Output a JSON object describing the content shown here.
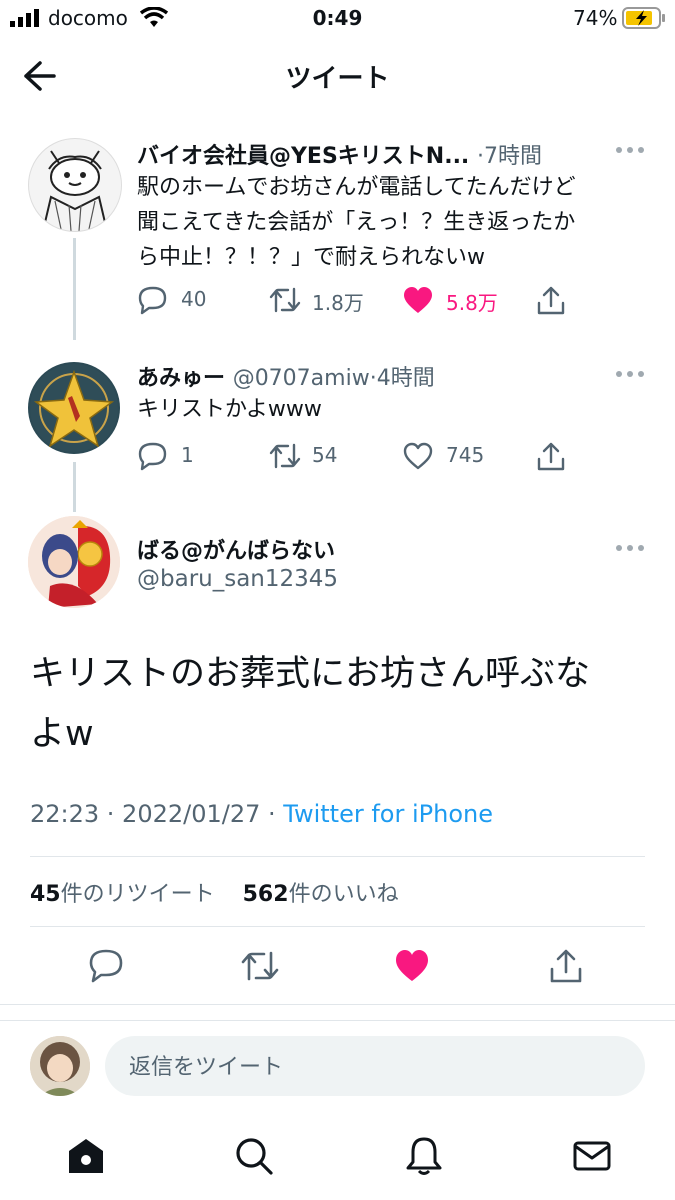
{
  "status_bar": {
    "carrier": "docomo",
    "time": "0:49",
    "battery": "74%"
  },
  "header": {
    "title": "ツイート"
  },
  "thread": [
    {
      "name": "バイオ会社員@YESキリストN...",
      "meta": "·7時間",
      "text_lines": [
        "駅のホームでお坊さんが電話してたんだけど",
        "聞こえてきた会話が「えっ！？生き返ったか",
        "ら中止！？！？」で耐えられないw"
      ],
      "replies": "40",
      "retweets": "1.8万",
      "likes": "5.8万",
      "liked": true
    },
    {
      "name": "あみゅー",
      "handle": "@0707amiw",
      "meta": "·4時間",
      "text_lines": [
        "キリストかよwww"
      ],
      "replies": "1",
      "retweets": "54",
      "likes": "745",
      "liked": false
    }
  ],
  "main_tweet": {
    "name": "ばる@がんばらない",
    "handle": "@baru_san12345",
    "text_lines": [
      "キリストのお葬式にお坊さん呼ぶな",
      "よw"
    ],
    "timestamp": "22:23 · 2022/01/27 · ",
    "source": "Twitter for iPhone",
    "retweet_count": "45",
    "retweet_label": "件のリツイート",
    "like_count": "562",
    "like_label": "件のいいね"
  },
  "reply_input": {
    "placeholder": "返信をツイート"
  },
  "colors": {
    "like": "#f91880",
    "link": "#1d9bf0",
    "muted": "#536471"
  }
}
